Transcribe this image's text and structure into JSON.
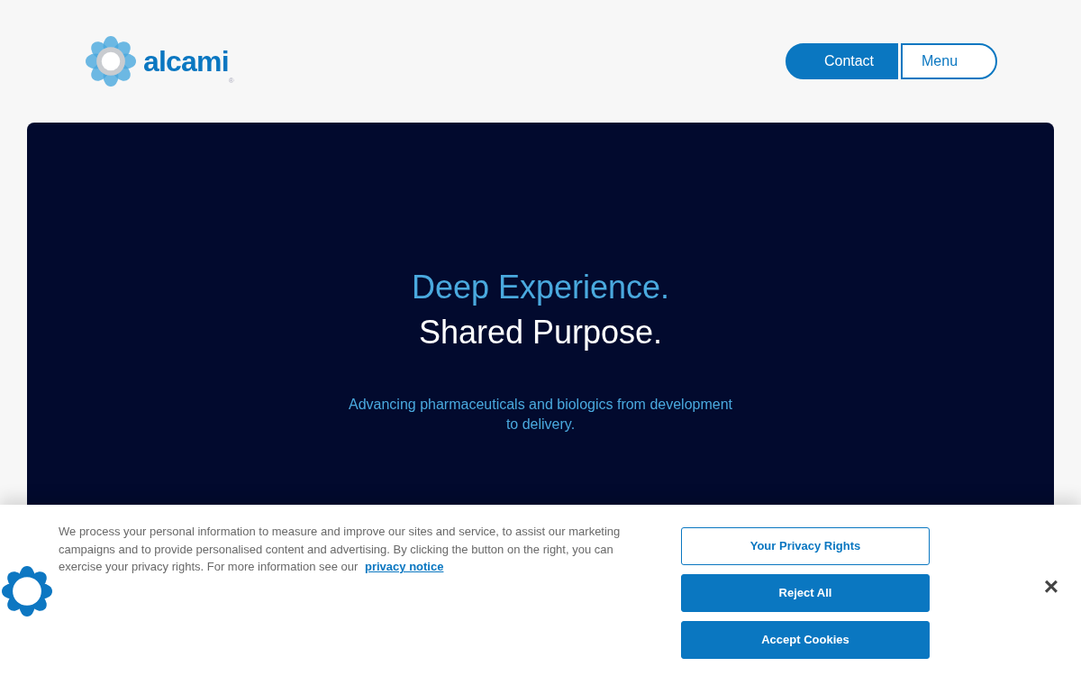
{
  "header": {
    "logo_text": "alcami",
    "logo_mark": "®",
    "buttons": [
      {
        "label": "Contact",
        "kind": "filled"
      },
      {
        "label": "Menu",
        "kind": "outline"
      }
    ]
  },
  "hero": {
    "heading_line_1": "Deep Experience.",
    "heading_line_2": "Shared Purpose.",
    "subtitle": "Advancing pharmaceuticals and biologics from development to delivery."
  },
  "cookie_banner": {
    "text": "We process your personal information to measure and improve our sites and service, to assist our marketing campaigns and to provide personalised content and advertising. By clicking the button on the right, you can exercise your privacy rights. For more information see our",
    "link": "privacy notice",
    "buttons": [
      {
        "label": "Your Privacy Rights",
        "kind": "outline"
      },
      {
        "label": "Reject All",
        "kind": "filled"
      },
      {
        "label": "Accept Cookies",
        "kind": "filled"
      }
    ],
    "close": "×"
  }
}
